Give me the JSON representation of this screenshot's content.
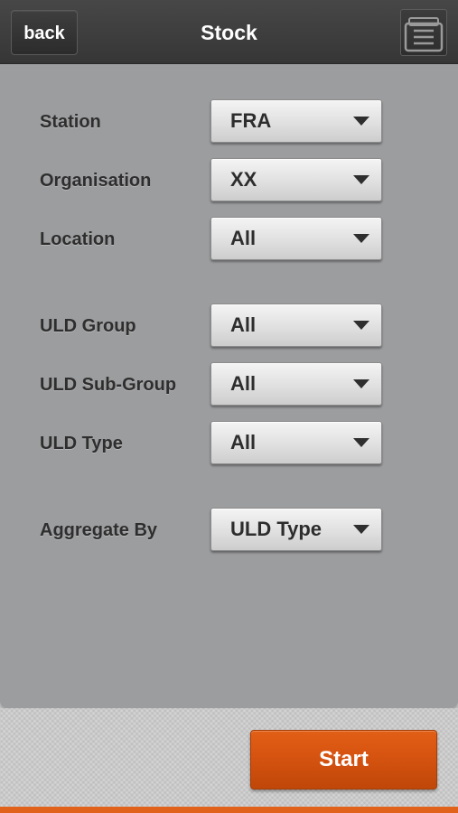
{
  "header": {
    "back_label": "back",
    "title": "Stock",
    "menu_icon": "list-stack-icon"
  },
  "form": {
    "fields": [
      {
        "label": "Station",
        "value": "FRA"
      },
      {
        "label": "Organisation",
        "value": "XX"
      },
      {
        "label": "Location",
        "value": "All"
      },
      {
        "label": "ULD Group",
        "value": "All"
      },
      {
        "label": "ULD Sub-Group",
        "value": "All"
      },
      {
        "label": "ULD Type",
        "value": "All"
      },
      {
        "label": "Aggregate By",
        "value": "ULD Type"
      }
    ]
  },
  "footer": {
    "start_label": "Start"
  },
  "colors": {
    "header_bg": "#3e3e3e",
    "panel_bg": "#9c9d9f",
    "accent": "#d4520f"
  }
}
